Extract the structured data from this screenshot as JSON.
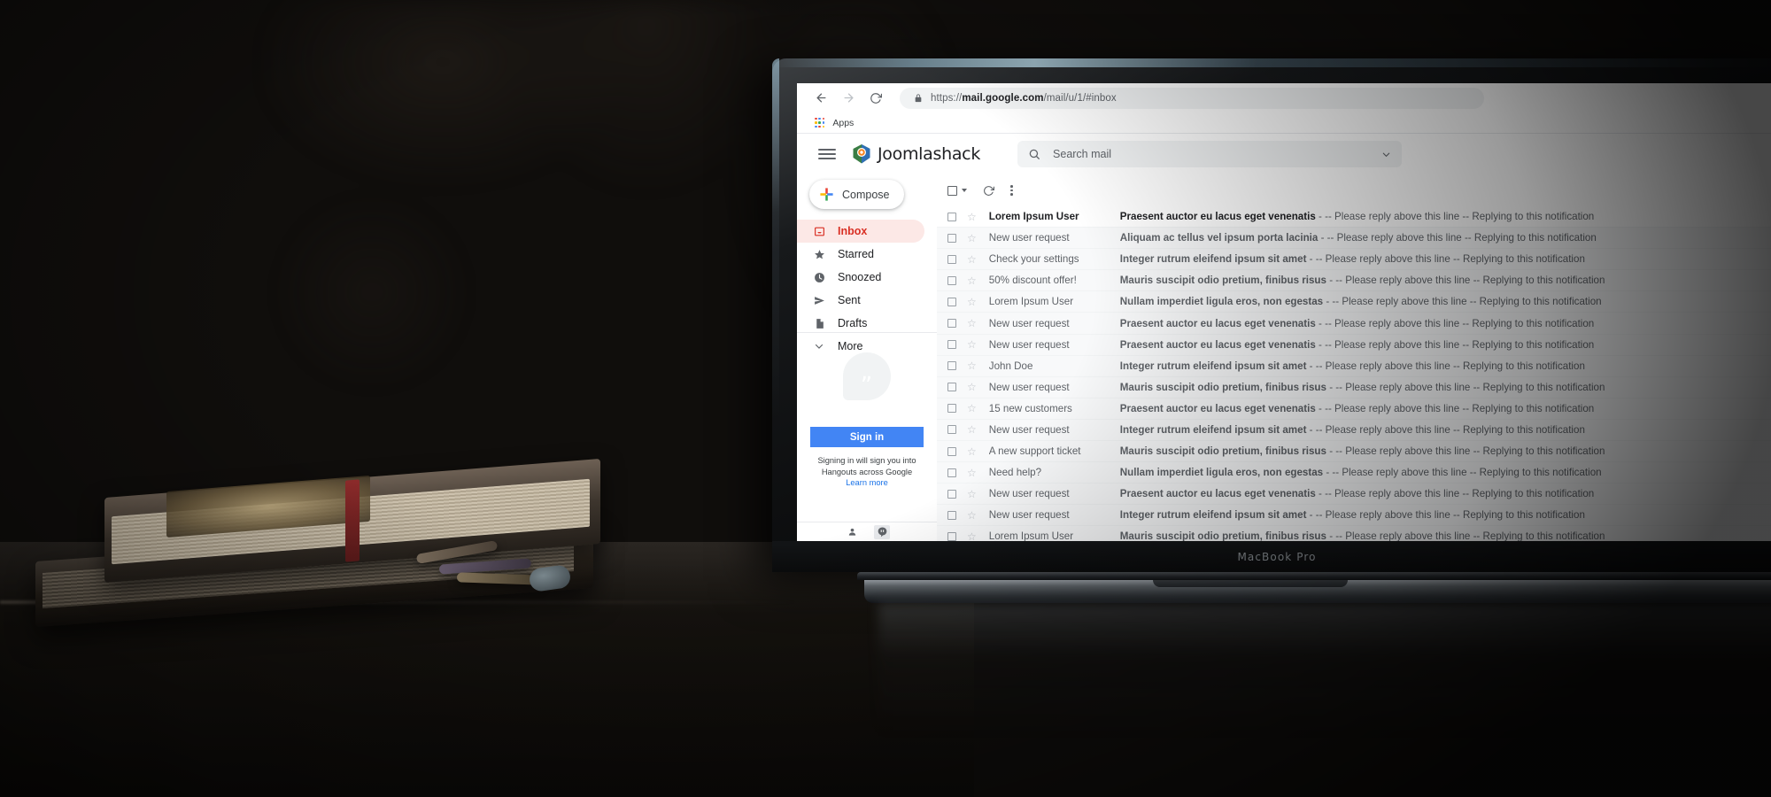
{
  "browser": {
    "back_icon": "back-arrow-icon",
    "forward_icon": "forward-arrow-icon",
    "reload_icon": "reload-icon",
    "lock_icon": "lock-icon",
    "url_scheme": "https://",
    "url_domain": "mail.google.com",
    "url_path": "/mail/u/1/#inbox",
    "bookmark_label": "Apps"
  },
  "gmail": {
    "menu_icon": "hamburger-menu-icon",
    "brand": "Joomlashack",
    "logo_icon": "joomlashack-shield-icon",
    "search": {
      "icon": "search-icon",
      "placeholder": "Search mail",
      "options_icon": "chevron-down-icon"
    },
    "compose": {
      "label": "Compose",
      "icon": "plus-icon"
    },
    "nav": [
      {
        "label": "Inbox",
        "icon": "inbox-icon",
        "active": true
      },
      {
        "label": "Starred",
        "icon": "star-icon",
        "active": false
      },
      {
        "label": "Snoozed",
        "icon": "clock-icon",
        "active": false
      },
      {
        "label": "Sent",
        "icon": "send-icon",
        "active": false
      },
      {
        "label": "Drafts",
        "icon": "file-icon",
        "active": false
      },
      {
        "label": "More",
        "icon": "chevron-down-icon",
        "active": false
      }
    ],
    "hangouts": {
      "avatar_icon": "hangouts-quote-icon",
      "signin_label": "Sign in",
      "note": "Signing in will sign you into Hangouts across Google",
      "learn_more": "Learn more",
      "footer_icons": [
        "contacts-person-icon",
        "hangouts-quote-icon"
      ]
    },
    "toolbar": {
      "select_all_icon": "checkbox-icon",
      "select_caret_icon": "chevron-down-icon",
      "refresh_icon": "refresh-icon",
      "more_icon": "three-dot-menu-icon"
    },
    "snippet_suffix": " - -- Please reply above this line -- Replying to this notification",
    "messages": [
      {
        "sender": "Lorem Ipsum User",
        "subject": "Praesent auctor eu lacus eget venenatis",
        "unread": true
      },
      {
        "sender": "New user request",
        "subject": "Aliquam ac tellus vel ipsum porta lacinia",
        "unread": false
      },
      {
        "sender": "Check your settings",
        "subject": "Integer rutrum eleifend ipsum sit amet",
        "unread": false
      },
      {
        "sender": "50% discount offer!",
        "subject": "Mauris suscipit odio pretium, finibus risus",
        "unread": false
      },
      {
        "sender": "Lorem Ipsum User",
        "subject": "Nullam imperdiet ligula eros, non egestas",
        "unread": false
      },
      {
        "sender": "New user request",
        "subject": "Praesent auctor eu lacus eget venenatis",
        "unread": false
      },
      {
        "sender": "New user request",
        "subject": "Praesent auctor eu lacus eget venenatis",
        "unread": false
      },
      {
        "sender": "John Doe",
        "subject": "Integer rutrum eleifend ipsum sit amet",
        "unread": false
      },
      {
        "sender": "New user request",
        "subject": "Mauris suscipit odio pretium, finibus risus",
        "unread": false
      },
      {
        "sender": "15 new customers",
        "subject": "Praesent auctor eu lacus eget venenatis",
        "unread": false
      },
      {
        "sender": "New user request",
        "subject": "Integer rutrum eleifend ipsum sit amet",
        "unread": false
      },
      {
        "sender": "A new support ticket",
        "subject": "Mauris suscipit odio pretium, finibus risus",
        "unread": false
      },
      {
        "sender": "Need help?",
        "subject": "Nullam imperdiet ligula eros, non egestas",
        "unread": false
      },
      {
        "sender": "New user request",
        "subject": "Praesent auctor eu lacus eget venenatis",
        "unread": false
      },
      {
        "sender": "New user request",
        "subject": "Integer rutrum eleifend ipsum sit amet",
        "unread": false
      },
      {
        "sender": "Lorem Ipsum User",
        "subject": "Mauris suscipit odio pretium, finibus risus",
        "unread": false
      }
    ]
  },
  "device": {
    "model_label": "MacBook Pro"
  },
  "colors": {
    "accent_red": "#d93025",
    "accent_blue": "#4285f4",
    "link_blue": "#1a73e8",
    "inbox_bg": "#fce8e6",
    "row_read_bg": "#f8f9fa",
    "chrome_grey": "#f1f3f4"
  }
}
